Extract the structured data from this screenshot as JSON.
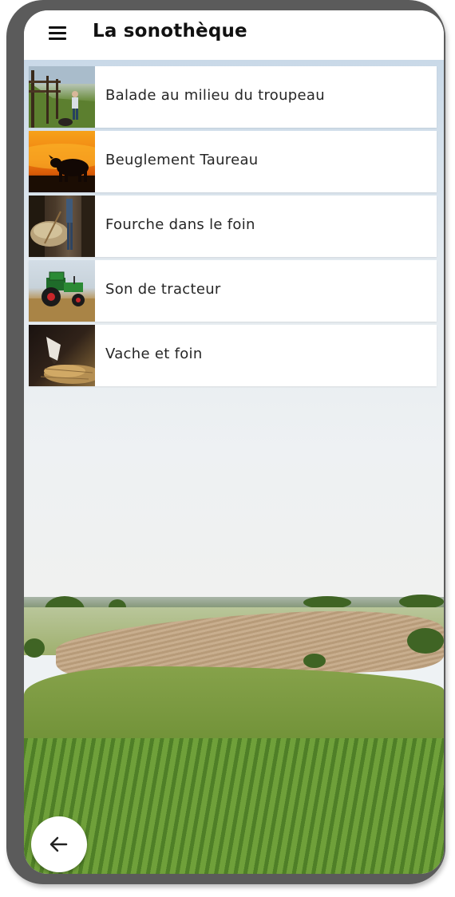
{
  "header": {
    "title": "La sonothèque",
    "menu_icon": "menu-icon"
  },
  "sounds": [
    {
      "label": "Balade au milieu du troupeau",
      "thumbnail": "cattle-farm-walk-photo"
    },
    {
      "label": "Beuglement Taureau",
      "thumbnail": "bull-sunset-silhouette-photo"
    },
    {
      "label": "Fourche dans le foin",
      "thumbnail": "pitchfork-hay-barn-photo"
    },
    {
      "label": "Son de tracteur",
      "thumbnail": "green-tractor-field-photo"
    },
    {
      "label": "Vache et foin",
      "thumbnail": "cow-eating-hay-photo"
    }
  ],
  "footer": {
    "back_icon": "arrow-left-icon"
  },
  "background": "farm-field-landscape-photo"
}
